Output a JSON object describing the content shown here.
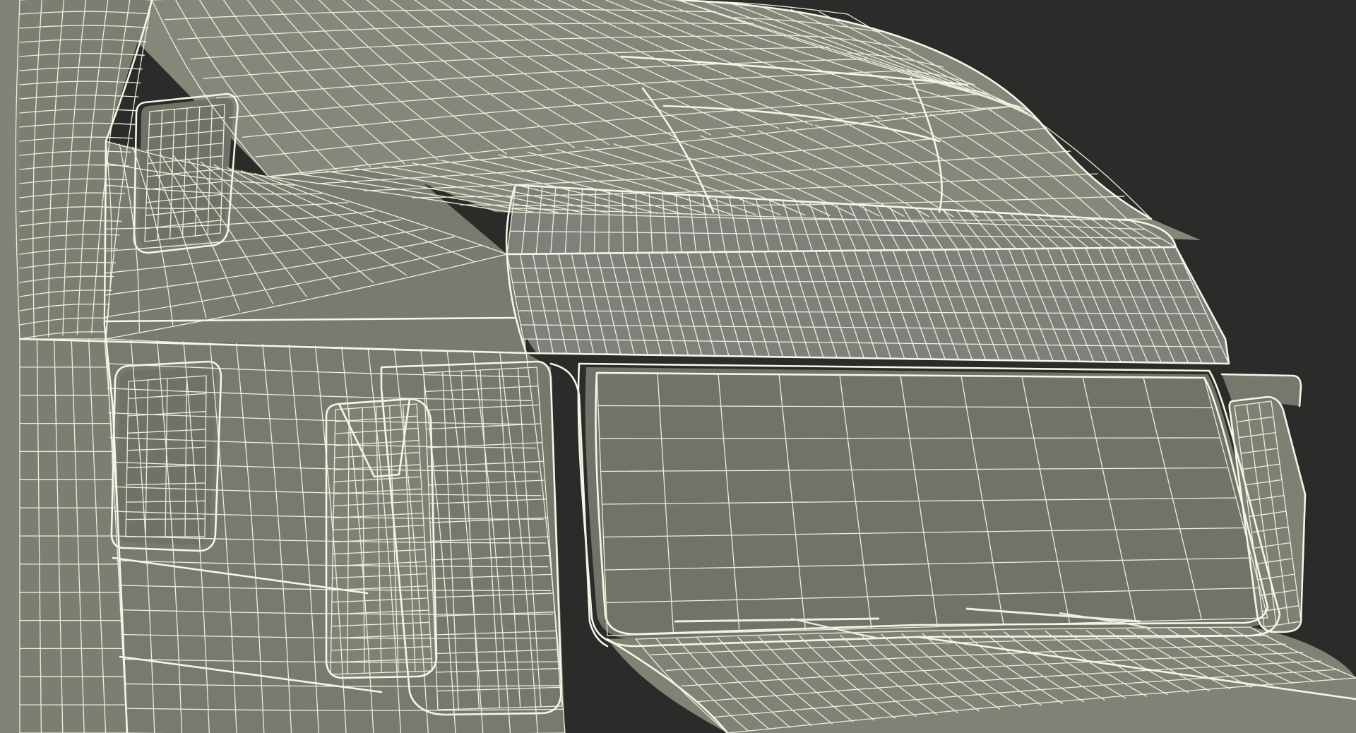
{
  "scene": {
    "subject": "truck-cab-wireframe",
    "colors": {
      "background": "#2b2b2a",
      "surface": "#7c7c71",
      "surface_light": "#85857a",
      "surface_dark": "#6e6e64",
      "window": "#727268",
      "wire": "#eeeedd",
      "edge": "#f6f6e8"
    }
  }
}
